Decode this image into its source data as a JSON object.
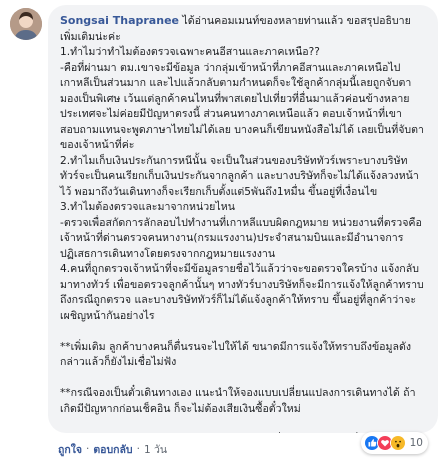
{
  "comment": {
    "author": "Songsai Thapranee",
    "intro": " ได้อ่านคอมเมนท์ของหลายท่านแล้ว ขอสรุปอธิบายเพิ่มเติมน่ะค่ะ",
    "body": "1.ทำไมว่าทำไมต้องตรวจเฉพาะคนอีสานและภาคเหนือ??\n-คือที่ผ่านมา ตม.เขาจะมีข้อมูล ว่ากลุ่มเข้าหน้าที่ภาคอีสานและภาคเหนือไปเกาหลีเป็นส่วนมาก และไปแล้วกลับตามกำหนดก็จะใช้ลูกค้ากลุ่มนี้เลยถูกจับตามองเป็นพิเศษ เว้นแต่ลูกค้าคนไหนที่พาสเตยไปเที่ยวที่อื่นมาแล้วค่อนข้างหลายประเทศจะไม่ค่อยมีปัญหาตรงนี้ ส่วนคนทางภาคเหนือแล้ว ตอบเจ้าหน้าที่เขาสอบถามแทนจะพูดภาษาไทยไม่ได้เลย บางคนก็เขียนหนังสือไม่ได้ เลยเป็นที่จับตาของเจ้าหน้าที่ค่ะ\n2.ทำไมเก็บเงินประกันการหนีนั้น จะเป็นในส่วนของบริษัททัวร์เพราะบางบริษัททัวร์จะเป็นคนเรียกเก็บเงินประกันจากลูกค้า และบางบริษัทก็จะไม่ได้แจ้งลวงหน้าไว้ พอมาถึงวันเดินทางก็จะเรียกเก็บตั้งแต่5พันถึง1หมื่น ขึ้นอยู่ที่เงื่อนไข\n3.ทำไมต้องตรวจและมาจากหน่วยไหน\n-ตรวจเพื่อสกัดการลักลอบไปทำงานที่เกาหลีแบบผิดกฎหมาย หน่วยงานที่ตรวจคือเจ้าหน้าที่ด่านตรวจคนหางาน(กรมแรงงาน)ประจำสนามบินและมีอำนาจการปฏิเสธการเดินทางโดยตรงจากกฎหมายแรงงาน\n4.คนที่ถูกตรวจเจ้าหน้าที่จะมีข้อมูลรายชื่อไว้แล้วว่าจะขอตรวจใครบ้าง แจ้งกลับมาทางทัวร์ เพื่อขอตรวจลูกค้านั้นๆ ทางทัวร์บางบริษัทก็จะมีการแจ้งให้ลูกค้าทราบถึงกรณีถูกตรวจ และบางบริษัททัวร์ก็ไม่ได้แจ้งลูกค้าให้ทราบ ขึ้นอยู่ที่ลูกค้าว่าจะเผชิญหน้ากันอย่างไร\n\n**เพิ่มเติม ลูกค้าบางคนก็ตื่นรนจะไปให้ได้ ขนาดมีการแจ้งให้ทราบถึงข้อมูลดังกล่าวแล้วก็ยังไม่เชื่อไม่ฟัง\n\n**กรณีจองเป็นตั๋วเดินทางเอง แนะนำให้จองแบบเปลี่ยนแปลงการเดินทางได้ ถ้าเกิดมีปัญหากก่อนเช็คอิน ก็จะไม่ต้องเสียเงินซื้อตั๋วใหม่\n\nยินดีให้คำปรึกษาน่ะค่ะถ้าข้อมูลตรงไหนอยากรู้เพิ่มเติม มาแลกเปลี่ยนประสบการณ์กันค่ะ"
  },
  "actions": {
    "like": "ถูกใจ",
    "reply": "ตอบกลับ",
    "time": "1 วัน"
  },
  "reactions": {
    "count": "10",
    "icons": [
      "like-icon",
      "love-icon",
      "wow-icon"
    ],
    "colors": {
      "like": "#1877f2",
      "love": "#f33e58",
      "wow": "#f7b928"
    }
  }
}
